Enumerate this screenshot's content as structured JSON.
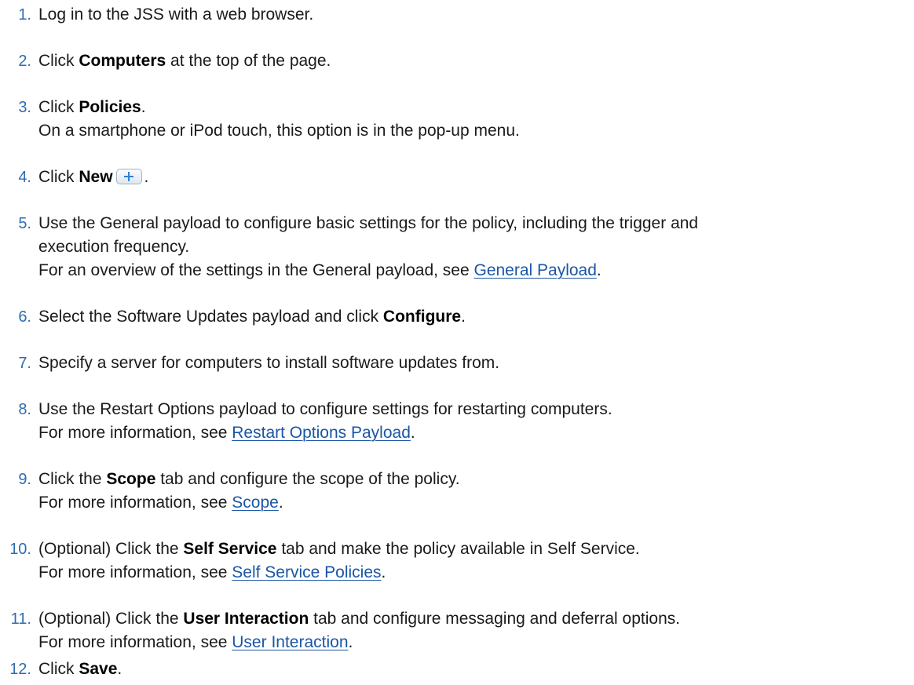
{
  "steps": [
    {
      "num": "1.",
      "text": "Log in to the JSS with a web browser."
    },
    {
      "num": "2.",
      "pre": "Click ",
      "bold": "Computers",
      "post": " at the top of the page."
    },
    {
      "num": "3.",
      "pre": "Click ",
      "bold": "Policies",
      "post": ".",
      "note": "On a smartphone or iPod touch, this option is in the pop-up menu."
    },
    {
      "num": "4.",
      "pre": "Click ",
      "bold": "New",
      "post": "."
    },
    {
      "num": "5.",
      "line1": "Use the General payload to configure basic settings for the policy, including the trigger and",
      "line2": "execution frequency.",
      "note_pre": "For an overview of the settings in the General payload, see ",
      "link": "General Payload",
      "note_post": "."
    },
    {
      "num": "6.",
      "pre": "Select the Software Updates payload and click ",
      "bold": "Configure",
      "post": "."
    },
    {
      "num": "7.",
      "text": "Specify a server for computers to install software updates from."
    },
    {
      "num": "8.",
      "text": "Use the Restart Options payload to configure settings for restarting computers.",
      "note_pre": "For more information, see ",
      "link": "Restart Options Payload",
      "note_post": "."
    },
    {
      "num": "9.",
      "pre": "Click the ",
      "bold": "Scope",
      "post": " tab and configure the scope of the policy.",
      "note_pre": "For more information, see ",
      "link": "Scope",
      "note_post": "."
    },
    {
      "num": "10.",
      "pre": "(Optional) Click the ",
      "bold": "Self Service",
      "post": " tab and make the policy available in Self Service.",
      "note_pre": "For more information, see ",
      "link": "Self Service Policies",
      "note_post": "."
    },
    {
      "num": "11.",
      "pre": "(Optional) Click the ",
      "bold": "User Interaction",
      "post": " tab and configure messaging and deferral options.",
      "note_pre": "For more information, see ",
      "link": "User Interaction",
      "note_post": "."
    },
    {
      "num": "12.",
      "pre": "Click ",
      "bold": "Save",
      "post": "."
    }
  ],
  "icons": {
    "new_button": "plus-icon"
  }
}
